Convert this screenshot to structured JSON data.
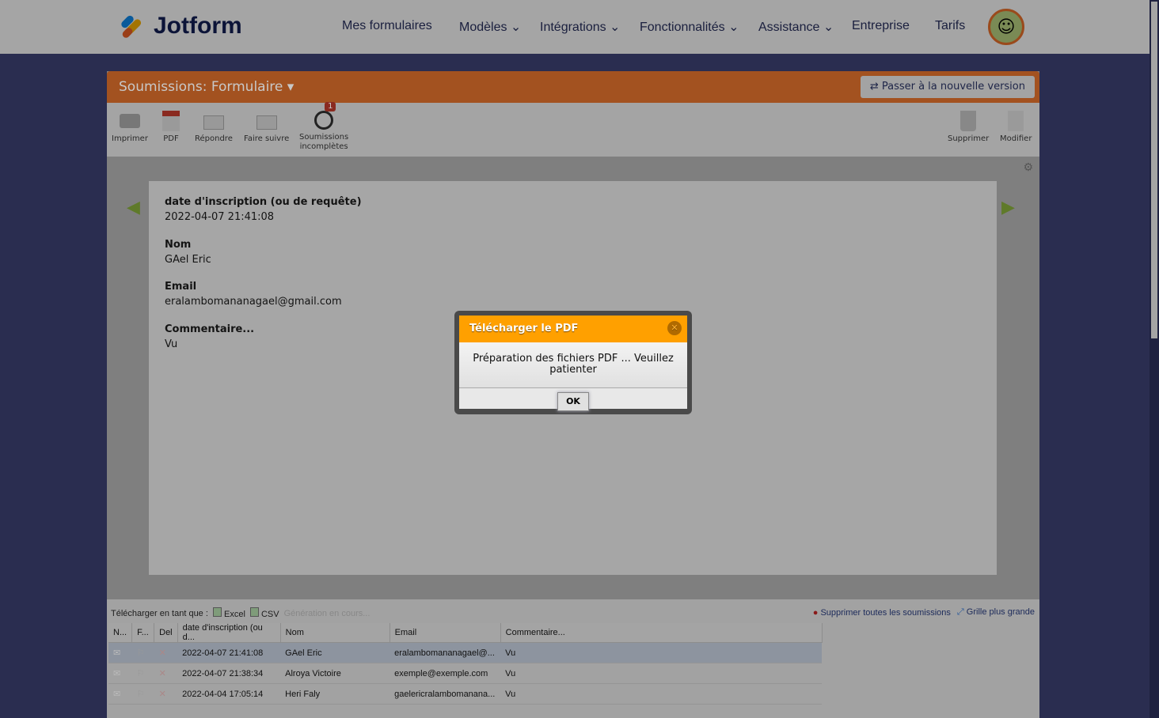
{
  "brand": "Jotform",
  "nav": [
    "Mes formulaires",
    "Modèles",
    "Intégrations",
    "Fonctionnalités",
    "Assistance",
    "Entreprise",
    "Tarifs"
  ],
  "panel": {
    "title": "Soumissions: Formulaire",
    "new_version": "Passer à la nouvelle version"
  },
  "toolbar": {
    "print": "Imprimer",
    "pdf": "PDF",
    "reply": "Répondre",
    "forward": "Faire suivre",
    "incomplete": "Soumissions",
    "incomplete2": "incomplètes",
    "incomplete_badge": "1",
    "delete": "Supprimer",
    "edit": "Modifier"
  },
  "record": [
    {
      "label": "date d'inscription (ou de requête)",
      "value": "2022-04-07 21:41:08"
    },
    {
      "label": "Nom",
      "value": "GAel Eric"
    },
    {
      "label": "Email",
      "value": "eralambomananagael@gmail.com"
    },
    {
      "label": "Commentaire...",
      "value": "Vu"
    }
  ],
  "download": {
    "label": "Télécharger en tant que :",
    "excel": "Excel",
    "csv": "CSV",
    "generating": "Génération en cours...",
    "delete_all": "Supprimer toutes les soumissions",
    "bigger_grid": "Grille plus grande"
  },
  "table": {
    "headers": [
      "N...",
      "F...",
      "Del",
      "date d'inscription (ou d...",
      "Nom",
      "Email",
      "Commentaire..."
    ],
    "rows": [
      {
        "date": "2022-04-07 21:41:08",
        "name": "GAel Eric",
        "email": "eralambomananagael@...",
        "comment": "Vu"
      },
      {
        "date": "2022-04-07 21:38:34",
        "name": "Alroya Victoire",
        "email": "exemple@exemple.com",
        "comment": "Vu"
      },
      {
        "date": "2022-04-04 17:05:14",
        "name": "Heri Faly",
        "email": "gaelericralambomanana...",
        "comment": "Vu"
      }
    ]
  },
  "dialog": {
    "title": "Télécharger le PDF",
    "message": "Préparation des fichiers PDF ... Veuillez patienter",
    "ok": "OK"
  }
}
